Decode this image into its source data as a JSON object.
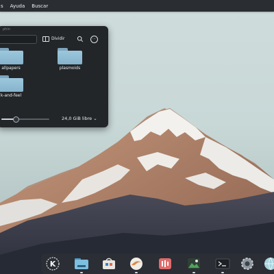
{
  "menubar": {
    "items": [
      "s",
      "Ayuda",
      "Buscar"
    ]
  },
  "dolphin": {
    "window_title": "phin",
    "toolbar": {
      "split_label": "Dividir"
    },
    "files": [
      {
        "name": "allpapers",
        "icon": "folder-icon"
      },
      {
        "name": "plasmoids",
        "icon": "folder-icon"
      },
      {
        "name": "k-and-feel",
        "icon": "folder-icon"
      }
    ],
    "status": {
      "free_space": "24,0 GiB libre",
      "zoom_level": 0.3
    }
  },
  "dock": {
    "items": [
      {
        "name": "kde-app-launcher-icon",
        "running": false
      },
      {
        "name": "dolphin-icon",
        "running": true
      },
      {
        "name": "discover-store-icon",
        "running": false
      },
      {
        "name": "browser-icon",
        "running": true
      },
      {
        "name": "music-player-icon",
        "running": false
      },
      {
        "name": "image-viewer-icon",
        "running": true
      },
      {
        "name": "terminal-icon",
        "running": true
      },
      {
        "name": "settings-icon",
        "running": false
      },
      {
        "name": "globe-icon",
        "running": false
      }
    ]
  },
  "colors": {
    "panel": "#2a2e32",
    "window_bg": "#232629",
    "folder_blue": "#9cc7dd",
    "sky": "#cfdcdc"
  }
}
